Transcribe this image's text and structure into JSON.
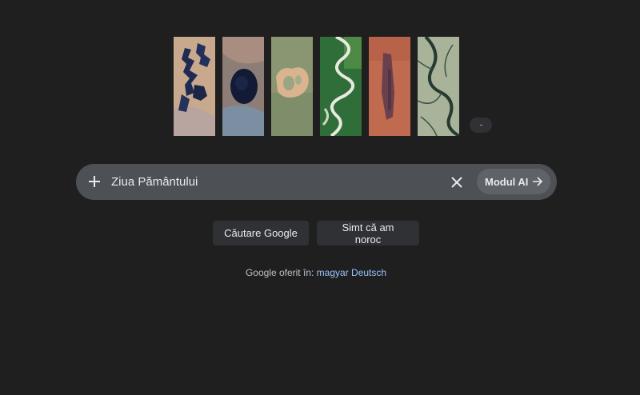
{
  "doodle": {
    "tiles": [
      {
        "name": "earth-tile-lakes",
        "colors": [
          "#c9a98e",
          "#b7a2a0",
          "#1e2a52"
        ]
      },
      {
        "name": "earth-tile-crater",
        "colors": [
          "#8c7e76",
          "#7c8fa2",
          "#121a35"
        ]
      },
      {
        "name": "earth-tile-island",
        "colors": [
          "#7e8d6b",
          "#9aa584",
          "#d9b48f"
        ]
      },
      {
        "name": "earth-tile-river",
        "colors": [
          "#2f6e39",
          "#4c8a45",
          "#e9eadf"
        ]
      },
      {
        "name": "earth-tile-desert",
        "colors": [
          "#c06a4f",
          "#a65a49",
          "#5b3d4b"
        ]
      },
      {
        "name": "earth-tile-delta",
        "colors": [
          "#98a78d",
          "#b4b9a1",
          "#253a31"
        ]
      }
    ],
    "share_icon": "share-icon"
  },
  "search": {
    "value": "Ziua Pământului",
    "add_icon": "plus-icon",
    "clear_icon": "close-icon",
    "ai_mode_label": "Modul AI",
    "ai_mode_icon": "arrow-right-icon"
  },
  "buttons": {
    "search_label": "Căutare Google",
    "lucky_label": "Simt că am noroc"
  },
  "languages": {
    "prefix": "Google oferit în:",
    "options": [
      "magyar",
      "Deutsch"
    ]
  }
}
